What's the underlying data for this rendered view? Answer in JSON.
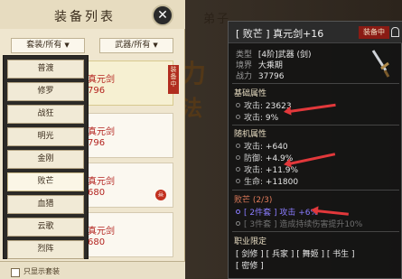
{
  "background": {
    "title_fragment": "弟子"
  },
  "equipment_list": {
    "title": "装备列表",
    "filter_set": "套装/所有",
    "filter_type": "武器/所有",
    "set_options": [
      "普渡",
      "修罗",
      "战狂",
      "明光",
      "金刚",
      "败芒",
      "血猎",
      "云歌",
      "烈阵"
    ],
    "cards": [
      {
        "name": "真元剑",
        "power": "796",
        "badge": "装备中"
      },
      {
        "name": "真元剑",
        "power": "796"
      },
      {
        "name": "真元剑",
        "power": "680"
      },
      {
        "name": "真元剑",
        "power": "680"
      }
    ],
    "footer_label": "只显示套装"
  },
  "detail": {
    "title": "[ 败芒 ] 真元剑+16",
    "equipped_badge": "装备中",
    "type_label": "类型",
    "type_value": "[4阶]武器 (剑)",
    "realm_label": "境界",
    "realm_value": "大乘期",
    "power_label": "战力",
    "power_value": "37796",
    "base_title": "基础属性",
    "base_attrs": [
      {
        "k": "攻击:",
        "v": "23623"
      },
      {
        "k": "攻击:",
        "v": "9%"
      }
    ],
    "random_title": "随机属性",
    "random_attrs": [
      {
        "k": "攻击:",
        "v": "+640"
      },
      {
        "k": "防御:",
        "v": "+4.9%"
      },
      {
        "k": "攻击:",
        "v": "+11.9%"
      },
      {
        "k": "生命:",
        "v": "+11800"
      }
    ],
    "set_title": "败芒 (2/3)",
    "set_bonus_2": "[ 2件套 ] 攻击 +6%",
    "set_bonus_3": "[ 3件套 ] 造成持续伤害提升10%",
    "job_title": "职业限定",
    "jobs_line1": "[ 剑修 ] [ 兵家 ] [ 舞姬 ] [ 书生 ]",
    "jobs_line2": "[ 密修 ]"
  },
  "colors": {
    "accent_red": "#e2383b",
    "rarity_red": "#b3231f",
    "set_purple": "#8a7cff"
  }
}
